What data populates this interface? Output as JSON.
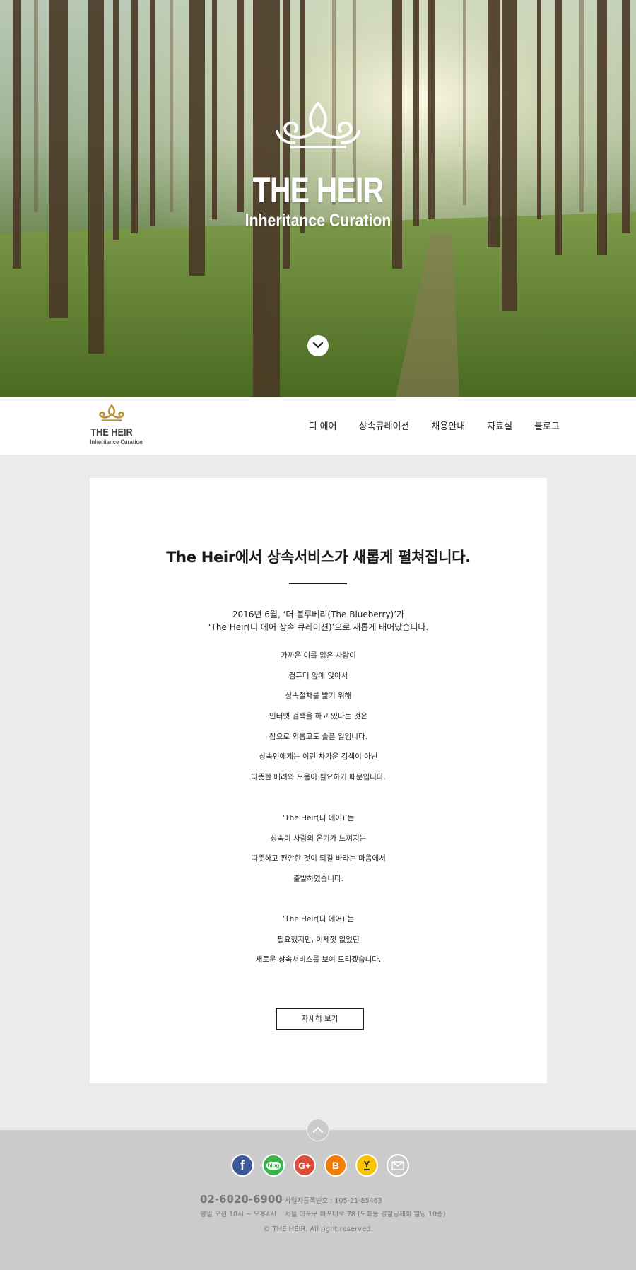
{
  "hero": {
    "title": "THE HEIR",
    "subtitle": "Inheritance Curation"
  },
  "nav": {
    "logo_title": "THE HEIR",
    "logo_subtitle": "Inheritance Curation",
    "items": [
      "디 에어",
      "상속큐레이션",
      "채용안내",
      "자료실",
      "블로그"
    ]
  },
  "content": {
    "heading": "The Heir에서 상속서비스가 새롭게 펼쳐집니다.",
    "intro_lines": [
      "2016년 6월, ‘더 블루베리(The Blueberry)’가",
      "‘The Heir(디 에어 상속 큐레이션)’으로 새롭게 태어났습니다."
    ],
    "paragraph1": [
      "가까운 이를 잃은 사람이",
      "컴퓨터 앞에 앉아서",
      "상속절차를 밟기 위해",
      "인터넷 검색을 하고 있다는 것은",
      "참으로 외롭고도 슬픈 일입니다.",
      "상속인에게는 이런 차가운 검색이 아닌",
      "따뜻한 배려와 도움이 필요하기 때문입니다."
    ],
    "paragraph2": [
      "‘The Heir(디 에어)’는",
      "상속이 사람의 온기가 느껴지는",
      "따뜻하고 편안한 것이 되길 바라는 마음에서",
      "출발하였습니다."
    ],
    "paragraph3": [
      "‘The Heir(디 에어)’는",
      "필요했지만, 이제껏 없었던",
      "새로운 상속서비스를 보여 드리겠습니다."
    ],
    "more_button": "자세히 보기"
  },
  "footer": {
    "social": [
      "facebook",
      "blog",
      "google-plus",
      "blogger",
      "yozm",
      "email"
    ],
    "social_labels": {
      "facebook": "f",
      "blog": "blog",
      "google_plus": "G+",
      "blogger": "B",
      "yozm": "Y"
    },
    "phone": "02-6020-6900",
    "hours": "평일 오전 10시 ~ 오후4시",
    "business_number": "사업자등록번호 : 105-21-85463",
    "address": "서울 마포구 마포대로 78 (도화동 경찰공제회 빌딩 10층)",
    "copyright": "© THE HEIR. All right reserved."
  },
  "colors": {
    "gold": "#b8913a",
    "footer_bg": "#cbcbcb",
    "page_bg": "#ebebeb"
  }
}
